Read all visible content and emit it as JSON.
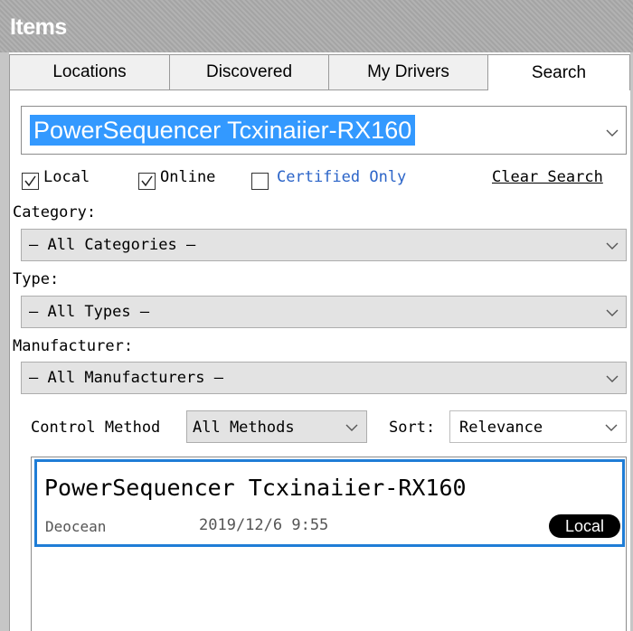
{
  "window": {
    "title": "Items"
  },
  "tabs": [
    {
      "label": "Locations"
    },
    {
      "label": "Discovered"
    },
    {
      "label": "My Drivers"
    },
    {
      "label": "Search"
    }
  ],
  "search": {
    "value": "PowerSequencer Tcxinaiier-RX160"
  },
  "filters": {
    "local": {
      "label": "Local",
      "checked": true
    },
    "online": {
      "label": "Online",
      "checked": true
    },
    "certified_only": {
      "label": "Certified Only",
      "checked": false
    },
    "clear_search": "Clear Search"
  },
  "category": {
    "label": "Category:",
    "value": "— All Categories —"
  },
  "type": {
    "label": "Type:",
    "value": "— All Types —"
  },
  "manufacturer": {
    "label": "Manufacturer:",
    "value": "— All Manufacturers —"
  },
  "control_method": {
    "label": "Control Method",
    "value": "All Methods"
  },
  "sort": {
    "label": "Sort:",
    "value": "Relevance"
  },
  "results": [
    {
      "name": "PowerSequencer Tcxinaiier-RX160",
      "manufacturer": "Deocean",
      "date": "2019/12/6 9:55",
      "badge": "Local"
    }
  ],
  "colors": {
    "accent": "#3399ff",
    "selection_border": "#1f7dd6",
    "link": "#2b64c8",
    "combo_bg": "#e3e3e3"
  },
  "icons": [
    "chevron-down-icon",
    "checkmark-icon"
  ]
}
